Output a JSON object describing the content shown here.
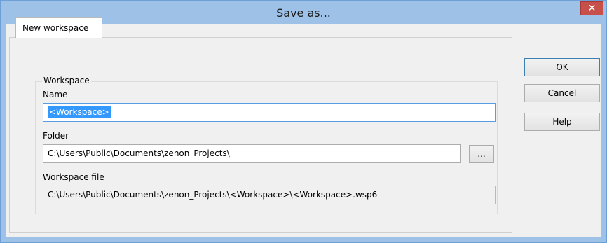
{
  "window": {
    "title": "Save as...",
    "close_glyph": "✕"
  },
  "tabs": [
    {
      "label": "New workspace",
      "selected": true
    }
  ],
  "workspace_group": {
    "title": "Workspace",
    "name_label": "Name",
    "name_value": "<Workspace>",
    "folder_label": "Folder",
    "folder_value": "C:\\Users\\Public\\Documents\\zenon_Projects\\",
    "browse_label": "...",
    "file_label": "Workspace file",
    "file_value": "C:\\Users\\Public\\Documents\\zenon_Projects\\<Workspace>\\<Workspace>.wsp6"
  },
  "buttons": {
    "ok": "OK",
    "cancel": "Cancel",
    "help": "Help"
  },
  "colors": {
    "title_background": "#9ec1e8",
    "close_button": "#c7504b",
    "selection": "#3399ff"
  }
}
